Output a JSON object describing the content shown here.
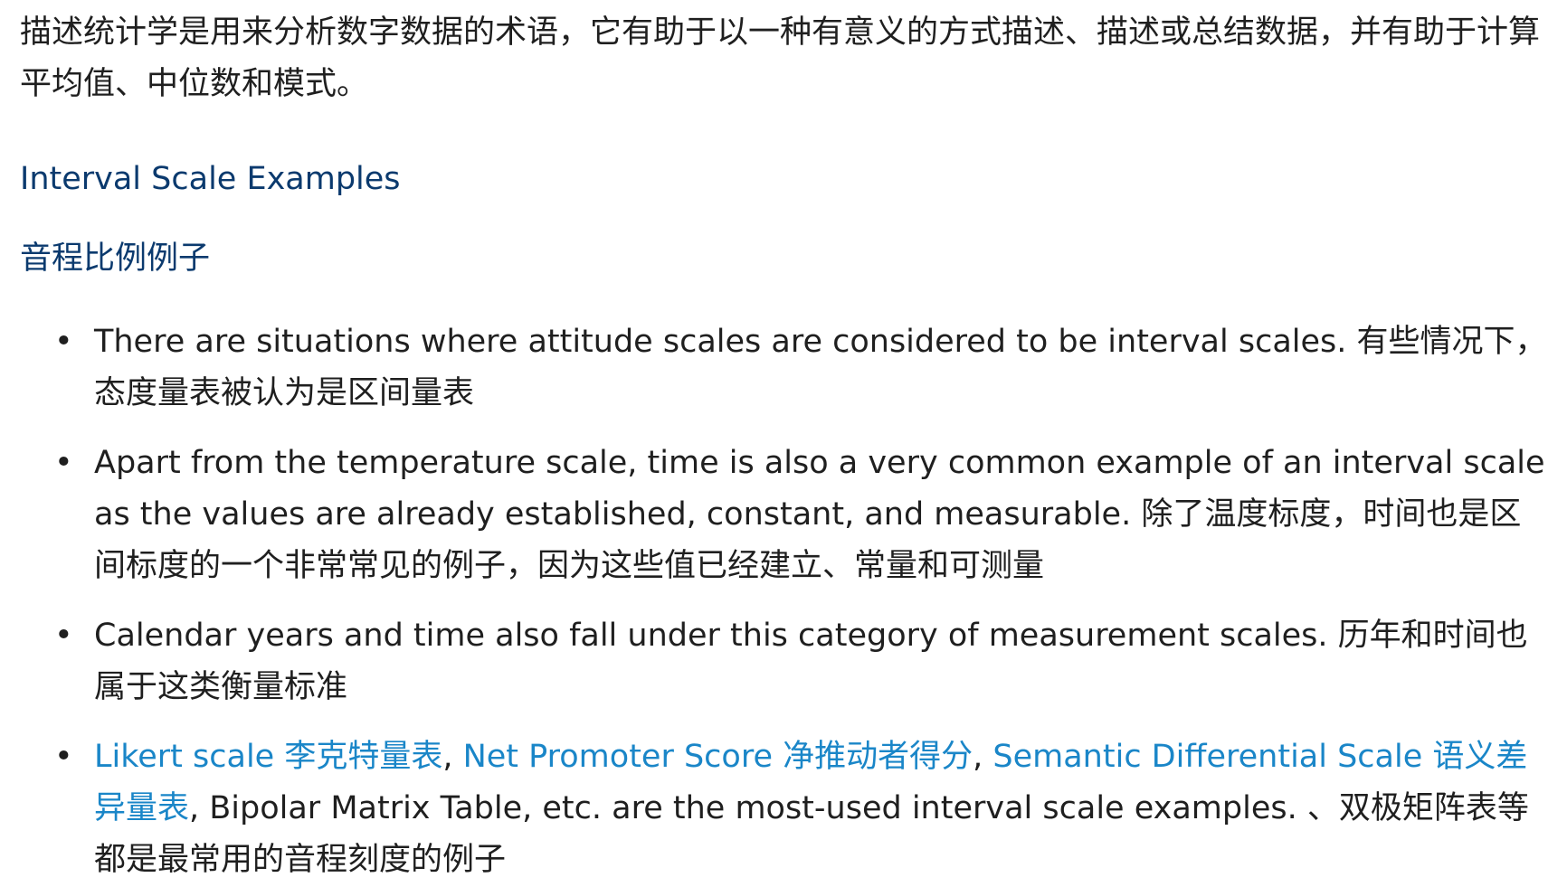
{
  "intro": "描述统计学是用来分析数字数据的术语，它有助于以一种有意义的方式描述、描述或总结数据，并有助于计算平均值、中位数和模式。",
  "heading_en": "Interval Scale Examples",
  "heading_zh": "音程比例例子",
  "bullets": [
    "There are situations where attitude scales are considered to be interval scales. 有些情况下，态度量表被认为是区间量表",
    "Apart from the temperature scale, time is also a very common example of an interval scale as the values are already established, constant, and measurable. 除了温度标度，时间也是区间标度的一个非常常见的例子，因为这些值已经建立、常量和可测量",
    "Calendar years and time also fall under this category of measurement scales. 历年和时间也属于这类衡量标准"
  ],
  "last_bullet": {
    "link1": "Likert scale 李克特量表",
    "sep1": ", ",
    "link2": "Net Promoter Score 净推动者得分",
    "sep2": ", ",
    "link3": "Semantic Differential Scale 语义差异量表",
    "rest": ", Bipolar Matrix Table, etc. are the most-used interval scale examples. 、双极矩阵表等都是最常用的音程刻度的例子"
  },
  "bullet_glyph": "•",
  "colors": {
    "text": "#1f1f1f",
    "heading": "#0b3a6e",
    "link": "#1a86c8",
    "background": "#ffffff"
  }
}
